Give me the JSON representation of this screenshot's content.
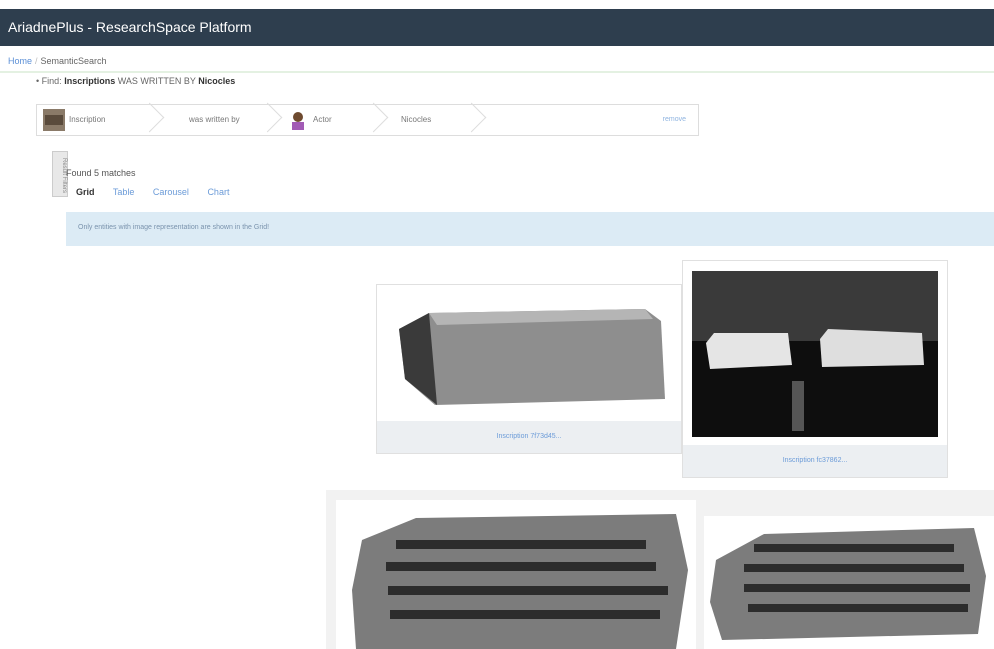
{
  "header": {
    "title": "AriadnePlus - ResearchSpace Platform"
  },
  "breadcrumb": {
    "home": "Home",
    "separator": "/",
    "current": "SemanticSearch"
  },
  "find": {
    "bullet": "•",
    "prefix": "Find:",
    "subject": "Inscriptions",
    "relation": "WAS WRITTEN BY",
    "object": "Nicocles"
  },
  "query": {
    "segments": [
      "Inscription",
      "was written by",
      "Actor",
      "Nicocles"
    ],
    "remove_label": "remove"
  },
  "sidebar_tab": {
    "label": "Result Filters"
  },
  "results": {
    "found_text": "Found 5 matches",
    "tabs": [
      "Grid",
      "Table",
      "Carousel",
      "Chart"
    ],
    "active_tab": "Grid",
    "info_text": "Only entities with image representation are shown in the Grid!",
    "cards": [
      {
        "caption": "Inscription 7f73d45..."
      },
      {
        "caption": "Inscription fc37862..."
      }
    ]
  }
}
